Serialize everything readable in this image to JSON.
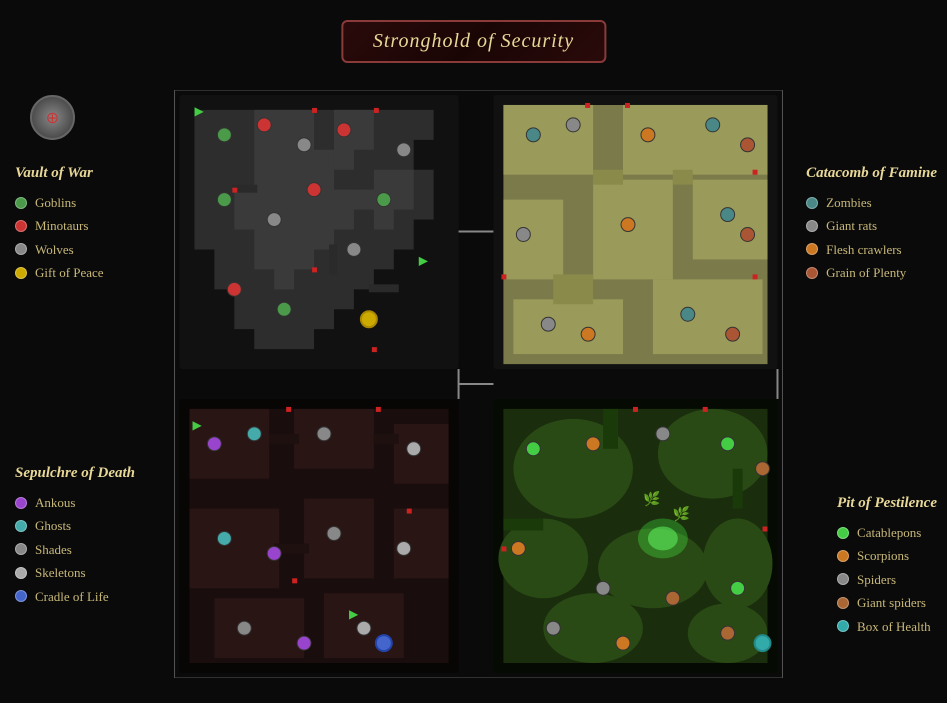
{
  "title": "Stronghold of Security",
  "compass": {
    "symbol": "⊕"
  },
  "legends": {
    "vault": {
      "title": "Vault of War",
      "items": [
        {
          "label": "Goblins",
          "color": "#4a9a4a"
        },
        {
          "label": "Minotaurs",
          "color": "#cc3333"
        },
        {
          "label": "Wolves",
          "color": "#888888"
        },
        {
          "label": "Gift of Peace",
          "color": "#ccaa00"
        }
      ]
    },
    "catacomb": {
      "title": "Catacomb of Famine",
      "items": [
        {
          "label": "Zombies",
          "color": "#4a8888"
        },
        {
          "label": "Giant rats",
          "color": "#888888"
        },
        {
          "label": "Flesh crawlers",
          "color": "#cc7722"
        },
        {
          "label": "Grain of Plenty",
          "color": "#aa5533"
        }
      ]
    },
    "sepulchre": {
      "title": "Sepulchre of Death",
      "items": [
        {
          "label": "Ankous",
          "color": "#9944cc"
        },
        {
          "label": "Ghosts",
          "color": "#44aaaa"
        },
        {
          "label": "Shades",
          "color": "#888888"
        },
        {
          "label": "Skeletons",
          "color": "#aaaaaa"
        },
        {
          "label": "Cradle of Life",
          "color": "#4466cc"
        }
      ]
    },
    "pit": {
      "title": "Pit of Pestilence",
      "items": [
        {
          "label": "Catablepons",
          "color": "#44cc44"
        },
        {
          "label": "Scorpions",
          "color": "#cc7722"
        },
        {
          "label": "Spiders",
          "color": "#888888"
        },
        {
          "label": "Giant spiders",
          "color": "#aa6633"
        },
        {
          "label": "Box of Health",
          "color": "#33aaaa"
        }
      ]
    }
  }
}
